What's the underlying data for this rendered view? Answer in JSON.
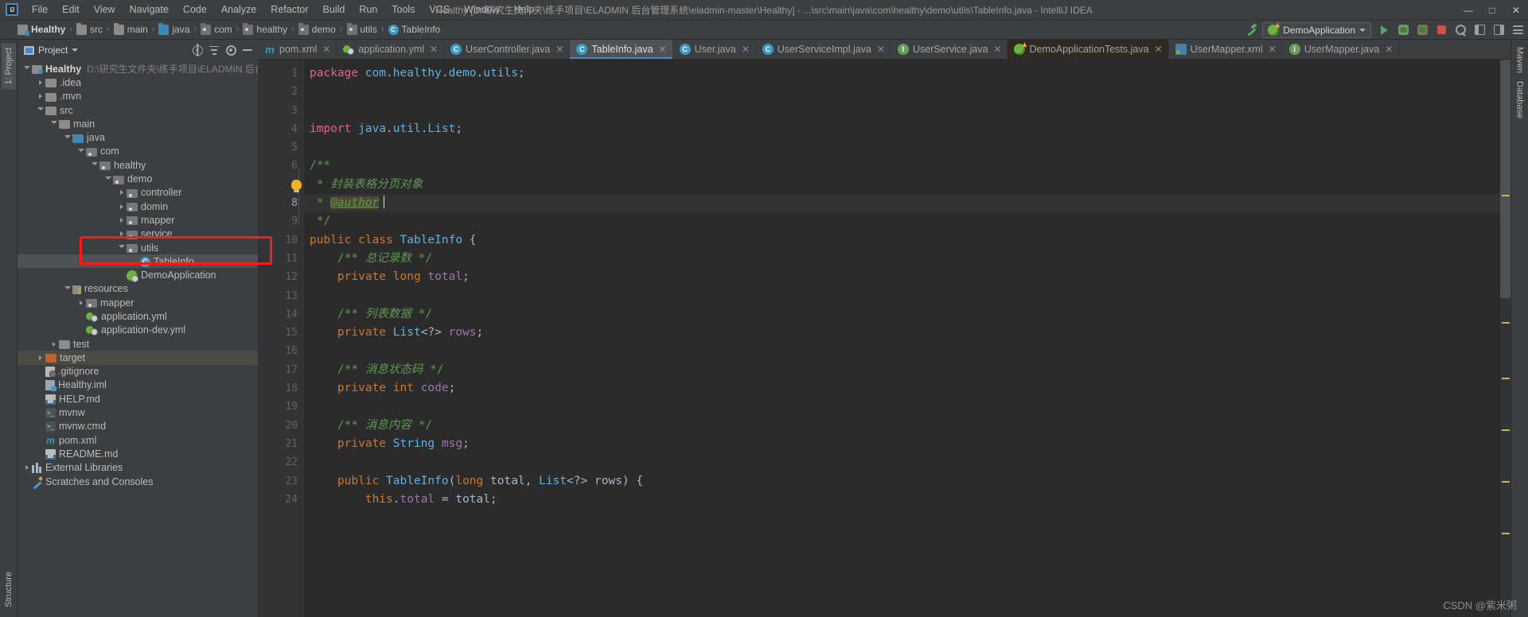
{
  "window": {
    "title": "Healthy [D:\\研究生文件夹\\练手项目\\ELADMIN 后台管理系统\\eladmin-master\\Healthy] - ...\\src\\main\\java\\com\\healthy\\demo\\utils\\TableInfo.java - IntelliJ IDEA",
    "minimize": "—",
    "maximize": "□",
    "close": "✕",
    "logo": "IJ"
  },
  "menu": [
    {
      "label": "File"
    },
    {
      "label": "Edit"
    },
    {
      "label": "View"
    },
    {
      "label": "Navigate"
    },
    {
      "label": "Code"
    },
    {
      "label": "Analyze"
    },
    {
      "label": "Refactor"
    },
    {
      "label": "Build"
    },
    {
      "label": "Run"
    },
    {
      "label": "Tools"
    },
    {
      "label": "VCS"
    },
    {
      "label": "Window"
    },
    {
      "label": "Help"
    }
  ],
  "breadcrumb": [
    {
      "label": "Healthy",
      "icon": "module-icon"
    },
    {
      "label": "src",
      "icon": "folder-icon"
    },
    {
      "label": "main",
      "icon": "folder-icon"
    },
    {
      "label": "java",
      "icon": "source-folder-icon"
    },
    {
      "label": "com",
      "icon": "package-icon"
    },
    {
      "label": "healthy",
      "icon": "package-icon"
    },
    {
      "label": "demo",
      "icon": "package-icon"
    },
    {
      "label": "utils",
      "icon": "package-icon"
    },
    {
      "label": "TableInfo",
      "icon": "class-icon",
      "glyph": "C"
    }
  ],
  "toolbar": {
    "run_config": "DemoApplication",
    "run_label": "Run",
    "debug_label": "Debug",
    "coverage_label": "Run with Coverage",
    "stop_label": "Stop",
    "build_label": "Build Project",
    "search_label": "Search Everywhere",
    "layout_left_label": "Hide Left Panel",
    "layout_right_label": "Hide Right Panel",
    "settings_label": "Settings"
  },
  "project_panel": {
    "title": "Project",
    "actions": [
      "select-opened-file",
      "collapse-all",
      "settings",
      "hide"
    ],
    "tree": [
      {
        "depth": 0,
        "arrow": "open",
        "icon": "module-icon",
        "label": "Healthy",
        "bold": true,
        "path": "D:\\研究生文件夹\\练手项目\\ELADMIN 后台管理系统"
      },
      {
        "depth": 1,
        "arrow": "closed",
        "icon": "folder-icon",
        "label": ".idea"
      },
      {
        "depth": 1,
        "arrow": "closed",
        "icon": "folder-icon",
        "label": ".mvn"
      },
      {
        "depth": 1,
        "arrow": "open",
        "icon": "folder-icon",
        "label": "src"
      },
      {
        "depth": 2,
        "arrow": "open",
        "icon": "folder-icon",
        "label": "main"
      },
      {
        "depth": 3,
        "arrow": "open",
        "icon": "source-folder-icon",
        "label": "java"
      },
      {
        "depth": 4,
        "arrow": "open",
        "icon": "package-icon",
        "label": "com"
      },
      {
        "depth": 5,
        "arrow": "open",
        "icon": "package-icon",
        "label": "healthy"
      },
      {
        "depth": 6,
        "arrow": "open",
        "icon": "package-icon",
        "label": "demo"
      },
      {
        "depth": 7,
        "arrow": "closed",
        "icon": "package-icon",
        "label": "controller"
      },
      {
        "depth": 7,
        "arrow": "closed",
        "icon": "package-icon",
        "label": "domin"
      },
      {
        "depth": 7,
        "arrow": "closed",
        "icon": "package-icon",
        "label": "mapper"
      },
      {
        "depth": 7,
        "arrow": "closed",
        "icon": "package-icon",
        "label": "service"
      },
      {
        "depth": 7,
        "arrow": "open",
        "icon": "package-icon",
        "label": "utils"
      },
      {
        "depth": 8,
        "arrow": "none",
        "icon": "class-icon",
        "label": "TableInfo",
        "selected": true,
        "glyph": "C"
      },
      {
        "depth": 7,
        "arrow": "none",
        "icon": "spring-class-icon",
        "label": "DemoApplication"
      },
      {
        "depth": 3,
        "arrow": "open",
        "icon": "resources-folder-icon",
        "label": "resources"
      },
      {
        "depth": 4,
        "arrow": "closed",
        "icon": "package-icon",
        "label": "mapper"
      },
      {
        "depth": 4,
        "arrow": "none",
        "icon": "yaml-icon",
        "label": "application.yml"
      },
      {
        "depth": 4,
        "arrow": "none",
        "icon": "yaml-icon",
        "label": "application-dev.yml"
      },
      {
        "depth": 2,
        "arrow": "closed",
        "icon": "folder-icon",
        "label": "test"
      },
      {
        "depth": 1,
        "arrow": "closed",
        "icon": "target-folder-icon",
        "label": "target",
        "highlight": true
      },
      {
        "depth": 1,
        "arrow": "none",
        "icon": "gitignore-icon",
        "label": ".gitignore"
      },
      {
        "depth": 1,
        "arrow": "none",
        "icon": "iml-icon",
        "label": "Healthy.iml"
      },
      {
        "depth": 1,
        "arrow": "none",
        "icon": "markdown-icon",
        "label": "HELP.md"
      },
      {
        "depth": 1,
        "arrow": "none",
        "icon": "script-icon",
        "label": "mvnw"
      },
      {
        "depth": 1,
        "arrow": "none",
        "icon": "script-icon",
        "label": "mvnw.cmd"
      },
      {
        "depth": 1,
        "arrow": "none",
        "icon": "maven-icon",
        "label": "pom.xml"
      },
      {
        "depth": 1,
        "arrow": "none",
        "icon": "markdown-icon",
        "label": "README.md"
      },
      {
        "depth": 0,
        "arrow": "closed",
        "icon": "library-icon",
        "label": "External Libraries"
      },
      {
        "depth": 0,
        "arrow": "none",
        "icon": "scratches-icon",
        "label": "Scratches and Consoles"
      }
    ]
  },
  "left_strip": {
    "top": [
      {
        "label": "1: Project",
        "selected": true
      }
    ],
    "bottom": [
      {
        "label": "Structure",
        "selected": false
      }
    ]
  },
  "right_strip": {
    "items": [
      {
        "label": "Maven"
      },
      {
        "label": "Database"
      }
    ]
  },
  "editor_tabs": [
    {
      "label": "pom.xml",
      "icon": "maven-icon",
      "state": "normal"
    },
    {
      "label": "application.yml",
      "icon": "yaml-icon",
      "state": "normal"
    },
    {
      "label": "UserController.java",
      "icon": "class-icon",
      "glyph": "C",
      "state": "normal"
    },
    {
      "label": "TableInfo.java",
      "icon": "class-icon",
      "glyph": "C",
      "state": "active"
    },
    {
      "label": "User.java",
      "icon": "class-icon",
      "glyph": "C",
      "state": "normal"
    },
    {
      "label": "UserServiceImpl.java",
      "icon": "class-icon",
      "glyph": "C",
      "state": "normal"
    },
    {
      "label": "UserService.java",
      "icon": "interface-icon",
      "glyph": "I",
      "state": "normal"
    },
    {
      "label": "DemoApplicationTests.java",
      "icon": "spring-test-icon",
      "state": "modified"
    },
    {
      "label": "UserMapper.xml",
      "icon": "xml-icon",
      "state": "normal"
    },
    {
      "label": "UserMapper.java",
      "icon": "interface-icon",
      "glyph": "I",
      "state": "normal"
    }
  ],
  "code": {
    "filename": "TableInfo.java",
    "lines": [
      {
        "n": 1,
        "tokens": [
          {
            "t": "package ",
            "c": "kw2"
          },
          {
            "t": "com",
            "c": "typ"
          },
          {
            "t": ".",
            "c": "plain"
          },
          {
            "t": "healthy",
            "c": "typ"
          },
          {
            "t": ".",
            "c": "plain"
          },
          {
            "t": "demo",
            "c": "typ"
          },
          {
            "t": ".",
            "c": "plain"
          },
          {
            "t": "utils",
            "c": "typ"
          },
          {
            "t": ";",
            "c": "plain"
          }
        ]
      },
      {
        "n": 2,
        "tokens": []
      },
      {
        "n": 3,
        "tokens": []
      },
      {
        "n": 4,
        "tokens": [
          {
            "t": "import ",
            "c": "kw2"
          },
          {
            "t": "java",
            "c": "typ"
          },
          {
            "t": ".",
            "c": "plain"
          },
          {
            "t": "util",
            "c": "typ"
          },
          {
            "t": ".",
            "c": "plain"
          },
          {
            "t": "List",
            "c": "typ"
          },
          {
            "t": ";",
            "c": "plain"
          }
        ]
      },
      {
        "n": 5,
        "tokens": []
      },
      {
        "n": 6,
        "tokens": [
          {
            "t": "/**",
            "c": "cmtn"
          }
        ],
        "fold": "open"
      },
      {
        "n": 7,
        "tokens": [
          {
            "t": " * ",
            "c": "cmtn"
          },
          {
            "t": "封装表格分页对象",
            "c": "cmt"
          }
        ],
        "bulb": true
      },
      {
        "n": 8,
        "tokens": [
          {
            "t": " * ",
            "c": "cmtn"
          },
          {
            "t": "@author",
            "c": "tag"
          },
          {
            "t": "",
            "c": "caret"
          }
        ],
        "current": true
      },
      {
        "n": 9,
        "tokens": [
          {
            "t": " */",
            "c": "cmtn"
          }
        ],
        "fold": "close"
      },
      {
        "n": 10,
        "tokens": [
          {
            "t": "public ",
            "c": "kw"
          },
          {
            "t": "class ",
            "c": "kw"
          },
          {
            "t": "TableInfo",
            "c": "typ"
          },
          {
            "t": " {",
            "c": "plain"
          }
        ]
      },
      {
        "n": 11,
        "tokens": [
          {
            "t": "    /** ",
            "c": "cmtn"
          },
          {
            "t": "总记录数",
            "c": "cmt"
          },
          {
            "t": " */",
            "c": "cmtn"
          }
        ]
      },
      {
        "n": 12,
        "tokens": [
          {
            "t": "    ",
            "c": "plain"
          },
          {
            "t": "private ",
            "c": "kw"
          },
          {
            "t": "long ",
            "c": "kw"
          },
          {
            "t": "total",
            "c": "fld"
          },
          {
            "t": ";",
            "c": "plain"
          }
        ]
      },
      {
        "n": 13,
        "tokens": []
      },
      {
        "n": 14,
        "tokens": [
          {
            "t": "    /** ",
            "c": "cmtn"
          },
          {
            "t": "列表数据",
            "c": "cmt"
          },
          {
            "t": " */",
            "c": "cmtn"
          }
        ]
      },
      {
        "n": 15,
        "tokens": [
          {
            "t": "    ",
            "c": "plain"
          },
          {
            "t": "private ",
            "c": "kw"
          },
          {
            "t": "List",
            "c": "typ"
          },
          {
            "t": "<?> ",
            "c": "plain"
          },
          {
            "t": "rows",
            "c": "fld"
          },
          {
            "t": ";",
            "c": "plain"
          }
        ]
      },
      {
        "n": 16,
        "tokens": []
      },
      {
        "n": 17,
        "tokens": [
          {
            "t": "    /** ",
            "c": "cmtn"
          },
          {
            "t": "消息状态码",
            "c": "cmt"
          },
          {
            "t": " */",
            "c": "cmtn"
          }
        ]
      },
      {
        "n": 18,
        "tokens": [
          {
            "t": "    ",
            "c": "plain"
          },
          {
            "t": "private ",
            "c": "kw"
          },
          {
            "t": "int ",
            "c": "kw"
          },
          {
            "t": "code",
            "c": "fld"
          },
          {
            "t": ";",
            "c": "plain"
          }
        ]
      },
      {
        "n": 19,
        "tokens": []
      },
      {
        "n": 20,
        "tokens": [
          {
            "t": "    /** ",
            "c": "cmtn"
          },
          {
            "t": "消息内容",
            "c": "cmt"
          },
          {
            "t": " */",
            "c": "cmtn"
          }
        ]
      },
      {
        "n": 21,
        "tokens": [
          {
            "t": "    ",
            "c": "plain"
          },
          {
            "t": "private ",
            "c": "kw"
          },
          {
            "t": "String ",
            "c": "typ"
          },
          {
            "t": "msg",
            "c": "fld"
          },
          {
            "t": ";",
            "c": "plain"
          }
        ]
      },
      {
        "n": 22,
        "tokens": []
      },
      {
        "n": 23,
        "tokens": [
          {
            "t": "    ",
            "c": "plain"
          },
          {
            "t": "public ",
            "c": "kw"
          },
          {
            "t": "TableInfo",
            "c": "meth"
          },
          {
            "t": "(",
            "c": "plain"
          },
          {
            "t": "long ",
            "c": "kw"
          },
          {
            "t": "total",
            "c": "plain"
          },
          {
            "t": ", ",
            "c": "plain"
          },
          {
            "t": "List",
            "c": "typ"
          },
          {
            "t": "<?> ",
            "c": "plain"
          },
          {
            "t": "rows",
            "c": "plain"
          },
          {
            "t": ") {",
            "c": "plain"
          }
        ],
        "gutterMark": "@",
        "fold": "open"
      },
      {
        "n": 24,
        "tokens": [
          {
            "t": "        ",
            "c": "plain"
          },
          {
            "t": "this",
            "c": "kw"
          },
          {
            "t": ".",
            "c": "plain"
          },
          {
            "t": "total",
            "c": "fld"
          },
          {
            "t": " = total;",
            "c": "plain"
          }
        ]
      }
    ]
  },
  "annotation": {
    "color": "#ff1a1a"
  },
  "watermark": "CSDN @紫米粥"
}
